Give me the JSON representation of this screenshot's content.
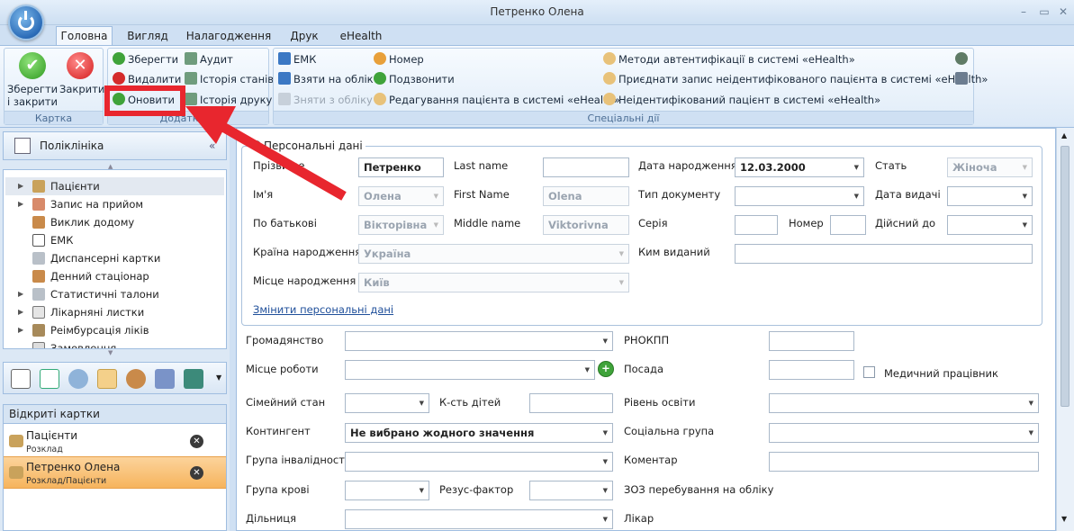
{
  "window": {
    "title": "Петренко Олена",
    "minimize": "–",
    "maximize": "▭",
    "close": "✕"
  },
  "tabs": [
    "Головна",
    "Вигляд",
    "Налагодження",
    "Друк",
    "eHealth"
  ],
  "ribbon": {
    "kartka": {
      "caption": "Картка",
      "save_close": "Зберегти\nі закрити",
      "close": "Закрити"
    },
    "dodatkovo": {
      "caption": "Додатково",
      "save": "Зберегти",
      "delete": "Видалити",
      "refresh": "Оновити",
      "audit": "Аудит",
      "history_states": "Історія станів",
      "history_print": "Історія друку"
    },
    "special": {
      "caption": "Спеціальні дії",
      "emk": "ЕМК",
      "take_record": "Взяти на облік",
      "remove_record": "Зняти з обліку",
      "number": "Номер",
      "call": "Подзвонити",
      "edit_patient_ehealth": "Редагування пацієнта в системі «eHealth»",
      "auth_methods": "Методи автентифікації в системі «eHealth»",
      "attach_record": "Приєднати запис неідентифікованого пацієнта в системі «eHealth»",
      "unidentified": "Неідентифікований пацієнт в системі «eHealth»"
    }
  },
  "sidebar": {
    "header": "Поліклініка",
    "items": [
      {
        "label": "Пацієнти",
        "expand": "▶",
        "selected": true
      },
      {
        "label": "Запис на прийом",
        "expand": "▶"
      },
      {
        "label": "Виклик додому",
        "expand": ""
      },
      {
        "label": "ЕМК",
        "expand": ""
      },
      {
        "label": "Диспансерні картки",
        "expand": ""
      },
      {
        "label": "Денний стаціонар",
        "expand": ""
      },
      {
        "label": "Статистичні талони",
        "expand": "▶"
      },
      {
        "label": "Лікарняні листки",
        "expand": "▶"
      },
      {
        "label": "Реімбурсація ліків",
        "expand": "▶"
      },
      {
        "label": "Замовлення",
        "expand": ""
      }
    ],
    "open_cards_header": "Відкриті картки",
    "open_cards": [
      {
        "title": "Пацієнти",
        "subtitle": "Розклад"
      },
      {
        "title": "Петренко Олена",
        "subtitle": "Розклад/Пацієнти"
      }
    ]
  },
  "personal": {
    "legend": "Персональні дані",
    "surname_label": "Прізвище",
    "surname": "Петренко",
    "name_label": "Ім'я",
    "name": "Олена",
    "patronymic_label": "По батькові",
    "patronymic": "Вікторівна",
    "country_label": "Країна народження",
    "country": "Україна",
    "birthplace_label": "Місце народження",
    "birthplace": "Київ",
    "lastname_label": "Last name",
    "lastname": "",
    "firstname_label": "First Name",
    "firstname": "Olena",
    "middlename_label": "Middle name",
    "middlename": "Viktorivna",
    "dob_label": "Дата народження",
    "dob": "12.03.2000",
    "doctype_label": "Тип документу",
    "series_label": "Серія",
    "number_label": "Номер",
    "issuer_label": "Ким виданий",
    "sex_label": "Стать",
    "sex": "Жіноча",
    "issue_date_label": "Дата видачі",
    "valid_to_label": "Дійсний до",
    "change_link": "Змінити персональні дані"
  },
  "form": {
    "citizenship": "Громадянство",
    "rnokpp": "РНОКПП",
    "workplace": "Місце роботи",
    "position": "Посада",
    "medic": "Медичний працівник",
    "marital": "Сімейний стан",
    "children": "К-сть дітей",
    "education": "Рівень освіти",
    "contingent": "Контингент",
    "contingent_value": "Не вибрано жодного значення",
    "social_group": "Соціальна група",
    "disability": "Група інвалідності",
    "comment": "Коментар",
    "blood": "Група крові",
    "rhesus": "Резус-фактор",
    "zoz": "ЗОЗ перебування на обліку",
    "district": "Дільниця",
    "doctor": "Лікар"
  },
  "colors": {
    "highlight": "#e8262e",
    "selected_card": "#f6b45d"
  }
}
